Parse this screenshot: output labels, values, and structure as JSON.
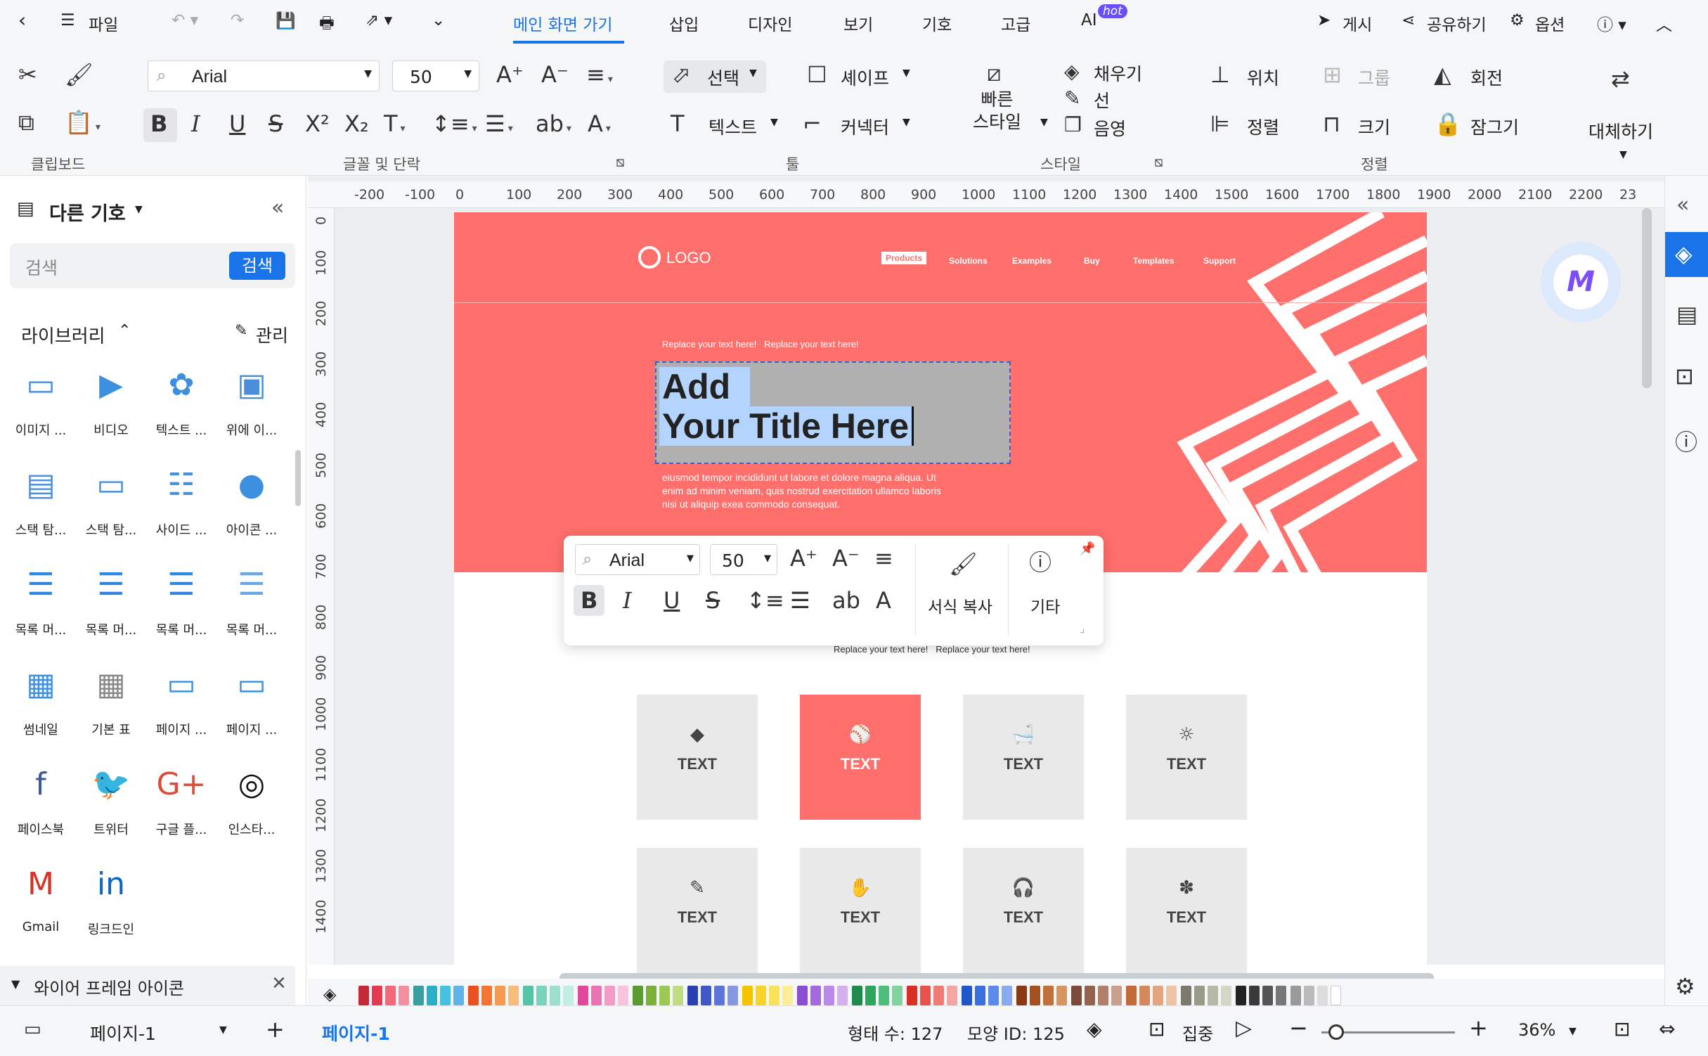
{
  "menu": {
    "file": "파일",
    "tabs": [
      "메인 화면 가기",
      "삽입",
      "디자인",
      "보기",
      "기호",
      "고급",
      "AI"
    ],
    "hot": "hot",
    "publish": "게시",
    "share": "공유하기",
    "options": "옵션"
  },
  "ribbon": {
    "font": "Arial",
    "size": "50",
    "groups": {
      "clipboard": "클립보드",
      "font_para": "글꼴 및 단락",
      "tools": "툴",
      "style": "스타일",
      "arrange": "정렬"
    },
    "tools": {
      "select": "선택",
      "shape": "셰이프",
      "text": "텍스트",
      "connector": "커넥터"
    },
    "style": {
      "quick_style": "빠른\n스타일",
      "fill": "채우기",
      "line": "선",
      "shadow": "음영"
    },
    "arrange": {
      "position": "위치",
      "group": "그룹",
      "rotate": "회전",
      "align": "정렬",
      "size": "크기",
      "lock": "잠그기"
    },
    "replace": "대체하기"
  },
  "sidebar": {
    "title": "다른 기호",
    "search_placeholder": "검색",
    "search_button": "검색",
    "library": "라이브러리",
    "manage": "관리",
    "items": [
      "이미지 ...",
      "비디오",
      "텍스트 ...",
      "위에 이...",
      "스택 탐...",
      "스택 탐...",
      "사이드 ...",
      "아이콘 ...",
      "목록 머...",
      "목록 머...",
      "목록 머...",
      "목록 머...",
      "썸네일",
      "기본 표",
      "페이지 ...",
      "페이지 ...",
      "페이스북",
      "트위터",
      "구글 플...",
      "인스타...",
      "Gmail",
      "링크드인"
    ],
    "footer": "와이어 프레임 아이콘"
  },
  "ruler": {
    "h": [
      "-200",
      "-100",
      "0",
      "100",
      "200",
      "300",
      "400",
      "500",
      "600",
      "700",
      "800",
      "900",
      "1000",
      "1100",
      "1200",
      "1300",
      "1400",
      "1500",
      "1600",
      "1700",
      "1800",
      "1900",
      "2000",
      "2100",
      "2200",
      "23"
    ],
    "v": [
      "0",
      "100",
      "200",
      "300",
      "400",
      "500",
      "600",
      "700",
      "800",
      "900",
      "1000",
      "1100",
      "1200",
      "1300",
      "1400"
    ]
  },
  "canvas": {
    "logo": "LOGO",
    "nav": [
      "Products",
      "Solutions",
      "Examples",
      "Buy",
      "Templates",
      "Support"
    ],
    "replace1": "Replace your text here!   Replace your text here!",
    "title1": "Add",
    "title2": "Your Title Here",
    "body": [
      "eiusmod tempor incididunt ut labore et dolore magna aliqua. Ut",
      "enim ad minim veniam, quis nostrud exercitation ullamco laboris",
      "nisi ut aliquip exea commodo consequat."
    ],
    "replace2": "Replace your text here!   Replace your text here!",
    "tiles": [
      "TEXT",
      "TEXT",
      "TEXT",
      "TEXT",
      "TEXT",
      "TEXT",
      "TEXT",
      "TEXT"
    ],
    "colors": {
      "hero": "#ff6f6b",
      "tile": "#e9e9e9",
      "selection": "#b3d4ff"
    }
  },
  "floatbar": {
    "font": "Arial",
    "size": "50",
    "format_painter": "서식 복사",
    "more": "기타"
  },
  "status": {
    "page_tab": "페이지-1",
    "active_page": "페이지-1",
    "shape_count": "형태 수: 127",
    "shape_id": "모양 ID: 125",
    "focus": "집중",
    "zoom": "36%"
  }
}
